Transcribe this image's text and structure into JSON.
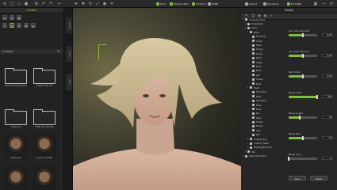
{
  "toolbar": {
    "buttons": [
      {
        "label": "Point"
      },
      {
        "label": "Morphcraftor"
      },
      {
        "label": "Conform"
      },
      {
        "label": "MrBB"
      },
      {
        "label": "Import"
      },
      {
        "label": "Transform"
      },
      {
        "label": "PortalSB"
      }
    ]
  },
  "left_panel": {
    "tab_label": "Content",
    "section_label": "Contents",
    "folders": [
      {
        "label": "Conforming Hair Kit 4"
      },
      {
        "label": "Custom Hair Kit"
      },
      {
        "label": "Preset"
      },
      {
        "label": "Preset Custom"
      }
    ],
    "items": [
      {
        "label": "Fluffy_Fun"
      },
      {
        "label": "Fluffy_Fun Bundle"
      }
    ],
    "thumbnails": [
      {
        "label": "Short_Hair"
      },
      {
        "label": "Curle_Ill hairStlr"
      }
    ]
  },
  "side_tabs": [
    "Content",
    "Scene",
    "Visual"
  ],
  "right_panel": {
    "tab_label": "Modify",
    "tree": [
      {
        "label": "Currently Used",
        "indent": 0
      },
      {
        "label": "Dressables",
        "indent": 1
      },
      {
        "label": "Actor",
        "indent": 1
      },
      {
        "label": "Body",
        "indent": 2
      },
      {
        "label": "Full Body",
        "indent": 3
      },
      {
        "label": "Chest",
        "indent": 3
      },
      {
        "label": "Head",
        "indent": 3
      },
      {
        "label": "Crown",
        "indent": 3
      },
      {
        "label": "Dome",
        "indent": 3
      },
      {
        "label": "Neck",
        "indent": 3
      },
      {
        "label": "Scalp",
        "indent": 3
      },
      {
        "label": "Face",
        "indent": 3
      },
      {
        "label": "Brow",
        "indent": 3
      },
      {
        "label": "Jaw",
        "indent": 3
      },
      {
        "label": "Cheek",
        "indent": 3
      },
      {
        "label": "Eyes",
        "indent": 3
      },
      {
        "label": "Head",
        "indent": 2
      },
      {
        "label": "Full Head",
        "indent": 3
      },
      {
        "label": "Bust",
        "indent": 3
      },
      {
        "label": "Forehead",
        "indent": 3
      },
      {
        "label": "Nose",
        "indent": 3
      },
      {
        "label": "Brow",
        "indent": 3
      },
      {
        "label": "Ear",
        "indent": 3
      },
      {
        "label": "Eyes",
        "indent": 3
      },
      {
        "label": "Cheek",
        "indent": 3
      },
      {
        "label": "Mouth",
        "indent": 3
      },
      {
        "label": "Chin",
        "indent": 3
      },
      {
        "label": "Jaw",
        "indent": 3
      },
      {
        "label": "Custom_Eye",
        "indent": 2
      },
      {
        "label": "Custom_Teeth",
        "indent": 2
      },
      {
        "label": "Shaide_jBrob_PN",
        "indent": 2
      },
      {
        "label": "Hair",
        "indent": 1
      },
      {
        "label": "Show Sub Items",
        "indent": 0
      }
    ],
    "properties": [
      {
        "label": "ALL Lower back size",
        "value": "0.00",
        "fill": 0.5
      },
      {
        "label": "ALL Lower back out",
        "value": "0.00",
        "fill": 0.5
      },
      {
        "label": "Back Under",
        "value": "0.00",
        "fill": 0.5
      },
      {
        "label": "Bangs Under",
        "value": "100",
        "fill": 1.0
      },
      {
        "label": "Bangs Length",
        "value": "40",
        "fill": 0.4
      },
      {
        "label": "Bangs Side",
        "value": "50",
        "fill": 0.5
      },
      {
        "label": "Bangs Long",
        "value": "0",
        "fill": 0.0
      }
    ],
    "buttons": {
      "save": "Save",
      "reset": "Reset"
    }
  }
}
